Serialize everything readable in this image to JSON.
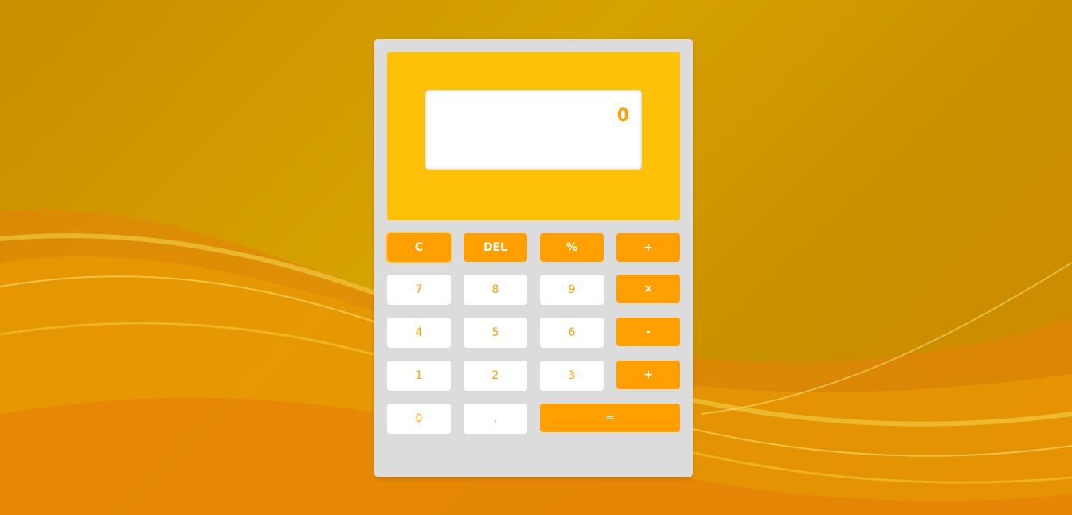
{
  "display": {
    "value": "0"
  },
  "buttons": {
    "clear": "C",
    "delete": "DEL",
    "percent": "%",
    "divide": "÷",
    "seven": "7",
    "eight": "8",
    "nine": "9",
    "multiply": "×",
    "four": "4",
    "five": "5",
    "six": "6",
    "minus": "-",
    "one": "1",
    "two": "2",
    "three": "3",
    "plus": "+",
    "zero": "0",
    "decimal": ".",
    "equals": "="
  },
  "colors": {
    "accent": "#ffa000",
    "display_panel": "#ffc107",
    "calculator_body": "#dcdcdc",
    "number_button_bg": "#ffffff"
  }
}
